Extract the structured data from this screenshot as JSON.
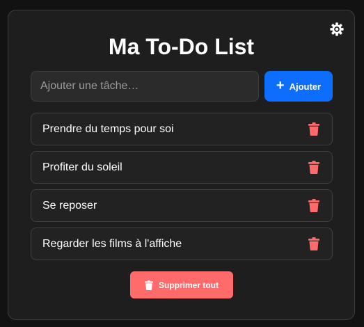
{
  "app": {
    "title": "Ma To-Do List",
    "settings_icon": "gear-icon"
  },
  "input": {
    "placeholder": "Ajouter une tâche…",
    "value": ""
  },
  "add_button": {
    "label": "Ajouter",
    "icon": "plus-icon"
  },
  "tasks": [
    {
      "text": "Prendre du temps pour soi",
      "delete_icon": "trash-icon"
    },
    {
      "text": "Profiter du soleil",
      "delete_icon": "trash-icon"
    },
    {
      "text": "Se reposer",
      "delete_icon": "trash-icon"
    },
    {
      "text": "Regarder les films à l'affiche",
      "delete_icon": "trash-icon"
    }
  ],
  "clear_button": {
    "label": "Supprimer tout",
    "icon": "trash-icon"
  },
  "colors": {
    "background": "#121212",
    "card": "#1e1e1e",
    "accent": "#0d6efd",
    "danger": "#ff6b6b"
  }
}
